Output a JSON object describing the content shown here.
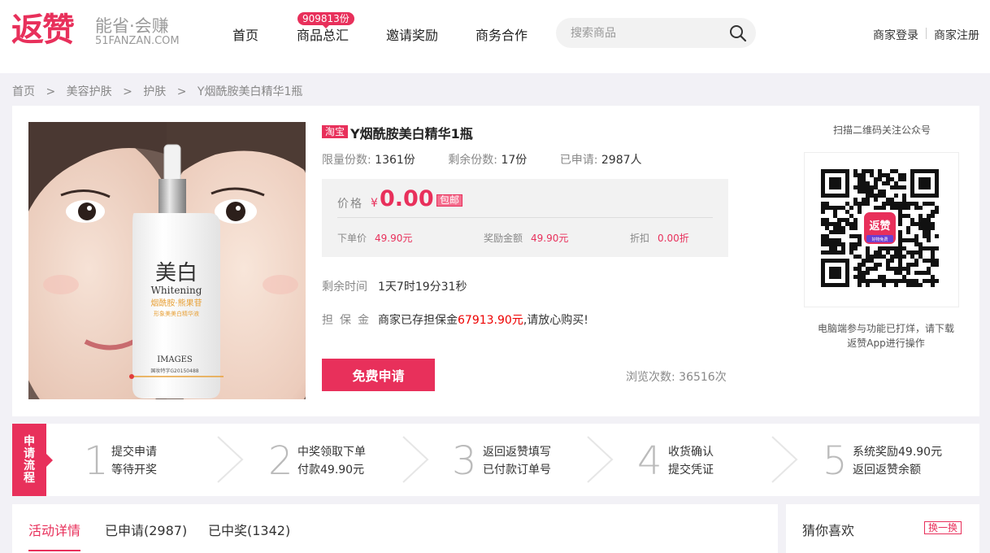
{
  "header": {
    "logo_text": "返赞",
    "slogan": "能省·会赚",
    "domain": "51FANZAN.COM",
    "nav": [
      {
        "label": "首页"
      },
      {
        "label": "商品总汇"
      },
      {
        "label": "邀请奖励"
      },
      {
        "label": "商务合作"
      }
    ],
    "nav_badge": "909813份",
    "search_placeholder": "搜索商品",
    "merchant_login": "商家登录",
    "merchant_register": "商家注册"
  },
  "breadcrumb": [
    "首页",
    ">",
    "美容护肤",
    ">",
    "护肤",
    ">",
    "Y烟酰胺美白精华1瓶"
  ],
  "product": {
    "source": "淘宝",
    "title": "Y烟酰胺美白精华1瓶",
    "image_text": {
      "main": "美白",
      "sub": "Whitening",
      "ingredients": "烟酰胺·熊果苷",
      "desc": "形象美美白精华液",
      "brand": "IMAGES",
      "reg": "国妆特字G20150488"
    },
    "stats": {
      "limit_label": "限量份数:",
      "limit_value": "1361份",
      "remain_label": "剩余份数:",
      "remain_value": "17份",
      "applied_label": "已申请:",
      "applied_value": "2987人"
    },
    "price": {
      "label": "价格",
      "currency": "¥",
      "value": "0.00",
      "shipping": "包邮",
      "order_label": "下单价",
      "order_value": "49.90元",
      "reward_label": "奖励金额",
      "reward_value": "49.90元",
      "discount_label": "折扣",
      "discount_value": "0.00折"
    },
    "remaining_time_label": "剩余时间",
    "remaining_time": "1天7时19分31秒",
    "deposit_label": "担保金",
    "deposit_prefix": "商家已存担保金",
    "deposit_amount": "67913.90元",
    "deposit_suffix": ",请放心购买!",
    "apply_button": "免费申请",
    "views_label": "浏览次数:",
    "views_value": "36516次"
  },
  "qr": {
    "title": "扫描二维码关注公众号",
    "center_label": "返赞",
    "center_sub": "好物免费",
    "note_line1": "电脑端参与功能已打烊，请下载",
    "note_line2": "返赞App进行操作"
  },
  "flow": {
    "tag": [
      "申",
      "请",
      "流",
      "程"
    ],
    "steps": [
      {
        "num": "1",
        "line1": "提交申请",
        "line2": "等待开奖"
      },
      {
        "num": "2",
        "line1": "中奖领取下单",
        "line2": "付款49.90元"
      },
      {
        "num": "3",
        "line1": "返回返赞填写",
        "line2": "已付款订单号"
      },
      {
        "num": "4",
        "line1": "收货确认",
        "line2": "提交凭证"
      },
      {
        "num": "5",
        "line1": "系统奖励49.90元",
        "line2": "返回返赞余额"
      }
    ]
  },
  "tabs": [
    {
      "label": "活动详情"
    },
    {
      "label": "已申请(2987)"
    },
    {
      "label": "已中奖(1342)"
    }
  ],
  "guess": {
    "title": "猜你喜欢",
    "refresh": "换一换"
  },
  "colors": {
    "accent": "#e8305b",
    "deposit": "#ee0000",
    "background": "#f2f1f6"
  }
}
